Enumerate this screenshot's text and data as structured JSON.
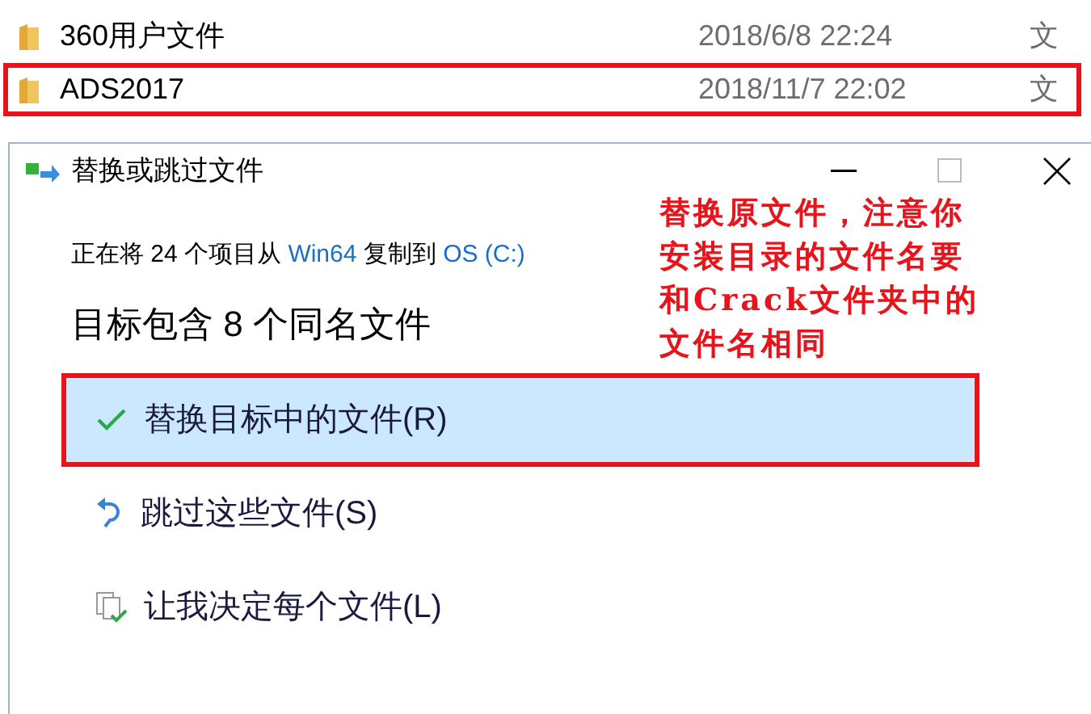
{
  "file_list": {
    "rows": [
      {
        "name": "360用户文件",
        "date": "2018/6/8 22:24",
        "type": "文",
        "highlighted": false
      },
      {
        "name": "ADS2017",
        "date": "2018/11/7 22:02",
        "type": "文",
        "highlighted": true
      }
    ]
  },
  "dialog": {
    "title": "替换或跳过文件",
    "copy_line": [
      {
        "kind": "text",
        "text": "正在将 24 个项目从 "
      },
      {
        "kind": "link",
        "text": "Win64"
      },
      {
        "kind": "text",
        "text": " 复制到 "
      },
      {
        "kind": "link",
        "text": "OS (C:)"
      }
    ],
    "heading": "目标包含 8 个同名文件",
    "options": [
      {
        "kind": "replace",
        "label": "替换目标中的文件(R)",
        "selected": true,
        "highlighted": true
      },
      {
        "kind": "skip",
        "label": "跳过这些文件(S)",
        "selected": false,
        "highlighted": false
      },
      {
        "kind": "decide",
        "label": "让我决定每个文件(L)",
        "selected": false,
        "highlighted": false
      }
    ]
  },
  "annotation": {
    "lines": [
      "替换原文件，注意你",
      "安装目录的文件名要",
      "和Crack文件夹中的",
      "文件名相同"
    ]
  }
}
